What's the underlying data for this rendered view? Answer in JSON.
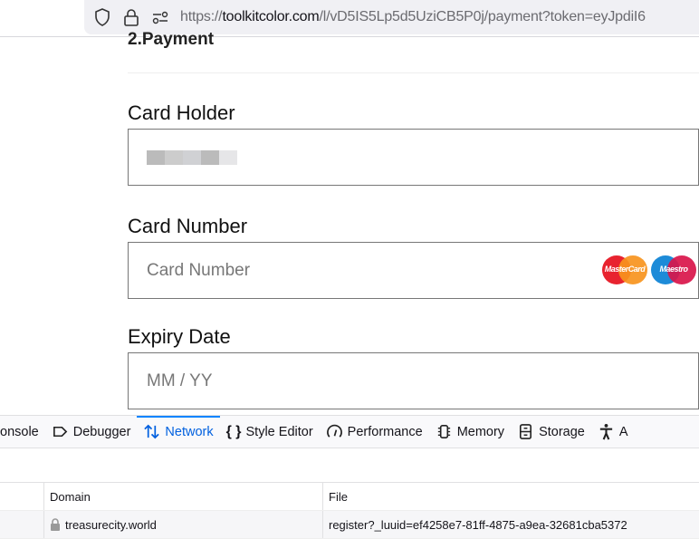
{
  "browser": {
    "url_scheme": "https://",
    "url_host": "toolkitcolor.com",
    "url_path": "/l/vD5IS5Lp5d5UziCB5P0j/payment?token=eyJpdiI6"
  },
  "page": {
    "step_title": "2.Payment",
    "card_holder": {
      "label": "Card Holder",
      "value_redacted": true
    },
    "card_number": {
      "label": "Card Number",
      "placeholder": "Card Number",
      "logos": [
        "MasterCard",
        "Maestro"
      ]
    },
    "expiry": {
      "label": "Expiry Date",
      "placeholder": "MM / YY"
    }
  },
  "devtools": {
    "tabs": [
      {
        "label": "onsole",
        "icon": "console-icon"
      },
      {
        "label": "Debugger",
        "icon": "debugger-icon"
      },
      {
        "label": "Network",
        "icon": "network-icon",
        "active": true
      },
      {
        "label": "Style Editor",
        "icon": "braces-icon"
      },
      {
        "label": "Performance",
        "icon": "gauge-icon"
      },
      {
        "label": "Memory",
        "icon": "memory-chip-icon"
      },
      {
        "label": "Storage",
        "icon": "storage-icon"
      },
      {
        "label": "A",
        "icon": "accessibility-icon"
      }
    ],
    "columns": [
      "Domain",
      "File"
    ],
    "rows": [
      {
        "domain": "treasurecity.world",
        "file": "register?_luuid=ef4258e7-81ff-4875-a9ea-32681cba5372",
        "secure": true
      }
    ],
    "accent": "#0060df"
  }
}
